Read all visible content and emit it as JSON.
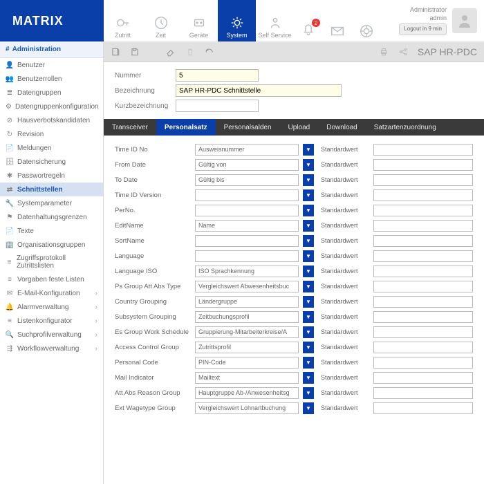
{
  "brand": "MATRIX",
  "account": {
    "role": "Administrator",
    "user": "admin",
    "logout": "Logout in 9 min"
  },
  "nav": [
    {
      "id": "zutritt",
      "label": "Zutritt"
    },
    {
      "id": "zeit",
      "label": "Zeit"
    },
    {
      "id": "geraete",
      "label": "Geräte"
    },
    {
      "id": "system",
      "label": "System",
      "active": true
    },
    {
      "id": "self",
      "label": "Self Service"
    }
  ],
  "notification_count": "2",
  "sidebar": {
    "header": "Administration",
    "items": [
      {
        "label": "Benutzer",
        "icon": "user"
      },
      {
        "label": "Benutzerrollen",
        "icon": "users"
      },
      {
        "label": "Datengruppen",
        "icon": "stack"
      },
      {
        "label": "Datengruppenkonfiguration",
        "icon": "gears"
      },
      {
        "label": "Hausverbotskandidaten",
        "icon": "ban"
      },
      {
        "label": "Revision",
        "icon": "revision"
      },
      {
        "label": "Meldungen",
        "icon": "doc"
      },
      {
        "label": "Datensicherung",
        "icon": "db"
      },
      {
        "label": "Passwortregeln",
        "icon": "star"
      },
      {
        "label": "Schnittstellen",
        "icon": "link",
        "active": true
      },
      {
        "label": "Systemparameter",
        "icon": "wrench"
      },
      {
        "label": "Datenhaltungsgrenzen",
        "icon": "flag"
      },
      {
        "label": "Texte",
        "icon": "doc"
      },
      {
        "label": "Organisationsgruppen",
        "icon": "org"
      },
      {
        "label": "Zugriffsprotokoll Zutrittslisten",
        "icon": "list"
      },
      {
        "label": "Vorgaben feste Listen",
        "icon": "list"
      },
      {
        "label": "E-Mail-Konfiguration",
        "icon": "mail",
        "sub": true
      },
      {
        "label": "Alarmverwaltung",
        "icon": "bell",
        "sub": true
      },
      {
        "label": "Listenkonfigurator",
        "icon": "list",
        "sub": true
      },
      {
        "label": "Suchprofilverwaltung",
        "icon": "search",
        "sub": true
      },
      {
        "label": "Workflowverwaltung",
        "icon": "flow",
        "sub": true
      }
    ]
  },
  "toolbar": {
    "title": "SAP HR-PDC"
  },
  "form": {
    "nummer_label": "Nummer",
    "nummer": "5",
    "bez_label": "Bezeichnung",
    "bez": "SAP HR-PDC Schnittstelle",
    "kurz_label": "Kurzbezeichnung",
    "kurz": ""
  },
  "tabs": [
    "Transceiver",
    "Personalsatz",
    "Personalsalden",
    "Upload",
    "Download",
    "Satzartenzuordnung"
  ],
  "active_tab": "Personalsatz",
  "stdlabel": "Standardwert",
  "rows": [
    {
      "label": "Time ID No",
      "value": "Ausweisnummer"
    },
    {
      "label": "From Date",
      "value": "Gültig von"
    },
    {
      "label": "To Date",
      "value": "Gültig bis"
    },
    {
      "label": "Time ID Version",
      "value": ""
    },
    {
      "label": "PerNo.",
      "value": ""
    },
    {
      "label": "EditName",
      "value": "Name"
    },
    {
      "label": "SortName",
      "value": ""
    },
    {
      "label": "Language",
      "value": ""
    },
    {
      "label": "Language ISO",
      "value": "ISO Sprachkennung"
    },
    {
      "label": "Ps Group Att Abs Type",
      "value": "Vergleichswert Abwesenheitsbuc"
    },
    {
      "label": "Country Grouping",
      "value": "Ländergruppe"
    },
    {
      "label": "Subsystem Grouping",
      "value": "Zeitbuchungsprofil"
    },
    {
      "label": "Es Group Work Schedule",
      "value": "Gruppierung-Mitarbeiterkreise/A"
    },
    {
      "label": "Access Control Group",
      "value": "Zutrittsprofil"
    },
    {
      "label": "Personal Code",
      "value": "PIN-Code"
    },
    {
      "label": "Mail Indicator",
      "value": "Mailtext"
    },
    {
      "label": "Att Abs Reason Group",
      "value": "Hauptgruppe Ab-/Anwesenheitsg"
    },
    {
      "label": "Ext Wagetype Group",
      "value": "Vergleichswert Lohnartbuchung"
    }
  ]
}
